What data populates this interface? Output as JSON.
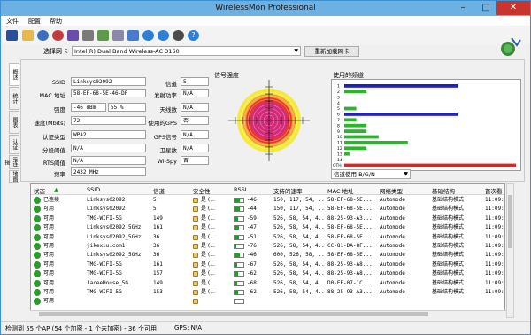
{
  "window": {
    "title": "WirelessMon Professional"
  },
  "menu": {
    "file": "文件",
    "config": "配置",
    "help": "帮助"
  },
  "toolbar": {
    "icons": [
      "save-icon",
      "open-icon",
      "globe-icon",
      "gps-icon",
      "monitor-icon",
      "print-icon",
      "bar-chart-icon",
      "settings-icon",
      "back-icon",
      "forward-icon",
      "network-icon",
      "help-icon"
    ]
  },
  "adapter": {
    "label": "选择网卡",
    "value": "Intel(R) Dual Band Wireless-AC 3160",
    "reload": "重新加载网卡"
  },
  "tabs": [
    "概述",
    "统计",
    "图表",
    "认证",
    "IP连接",
    "地图"
  ],
  "info": {
    "ssid_label": "SSID",
    "ssid": "Linksys02092",
    "mac_label": "MAC 地址",
    "mac": "58-EF-68-5E-46-DF",
    "strength_label": "强度",
    "strength_dbm": "-46 dBm",
    "strength_pct": "55 %",
    "speed_label": "速度(Mbits)",
    "speed": "72",
    "auth_label": "认证类型",
    "auth": "WPA2",
    "frag_label": "分段阈值",
    "frag": "N/A",
    "rts_label": "RTS阈值",
    "rts": "N/A",
    "freq_label": "频率",
    "freq": "2432 MHz",
    "channel_label": "信道",
    "channel": "5",
    "txpower_label": "发射功率",
    "txpower": "N/A",
    "antenna_label": "天线数",
    "antenna": "N/A",
    "gps_label": "使用的GPS",
    "gps": "否",
    "gpssignal_label": "GPS信号",
    "gpssignal": "N/A",
    "sats_label": "卫星数",
    "sats": "N/A",
    "wispy_label": "Wi-Spy",
    "wispy": "否"
  },
  "signal": {
    "title": "信号强度",
    "level_pct": 55
  },
  "channels": {
    "title": "使用的频道",
    "select": "信道使用 B/G/N",
    "labels": [
      "1",
      "2",
      "3",
      "4",
      "5",
      "6",
      "7",
      "8",
      "9",
      "10",
      "11",
      "12",
      "13",
      "14",
      "OTH"
    ],
    "bars": [
      {
        "ch": "1",
        "value": 0.66,
        "color": "#1f1fc8"
      },
      {
        "ch": "2",
        "value": 0.13,
        "color": "#2bb52b"
      },
      {
        "ch": "3",
        "value": 0.0,
        "color": "#2bb52b"
      },
      {
        "ch": "4",
        "value": 0.0,
        "color": "#2bb52b"
      },
      {
        "ch": "5",
        "value": 0.07,
        "color": "#2bb52b"
      },
      {
        "ch": "6",
        "value": 0.66,
        "color": "#1f1fc8"
      },
      {
        "ch": "7",
        "value": 0.07,
        "color": "#2bb52b"
      },
      {
        "ch": "8",
        "value": 0.13,
        "color": "#2bb52b"
      },
      {
        "ch": "9",
        "value": 0.13,
        "color": "#2bb52b"
      },
      {
        "ch": "10",
        "value": 0.2,
        "color": "#2bb52b"
      },
      {
        "ch": "11",
        "value": 0.37,
        "color": "#2bb52b"
      },
      {
        "ch": "12",
        "value": 0.13,
        "color": "#2bb52b"
      },
      {
        "ch": "13",
        "value": 0.03,
        "color": "#2bb52b"
      },
      {
        "ch": "14",
        "value": 0.0,
        "color": "#2bb52b"
      },
      {
        "ch": "OTH",
        "value": 1.0,
        "color": "#e02424"
      }
    ]
  },
  "table": {
    "headers": [
      "状态",
      "SSID",
      "信道",
      "安全性",
      "RSSI",
      "支持的速率",
      "MAC 地址",
      "网络类型",
      "基础结构",
      "首次看"
    ],
    "rows": [
      {
        "status": "已连接",
        "color": "#2d9a2d",
        "ssid": "Linksys02092",
        "ch": "5",
        "sec": "是 (...",
        "rssi": "-46",
        "lvl": 0.55,
        "rates": "150, 117, 54, ...",
        "mac": "58-EF-68-5E...",
        "type": "Automode",
        "infra": "基础结构模式",
        "first": "11:09:"
      },
      {
        "status": "可用",
        "color": "#2d9a2d",
        "ssid": "Linksys02092",
        "ch": "5",
        "sec": "是 (...",
        "rssi": "-44",
        "lvl": 0.57,
        "rates": "150, 117, 54, ...",
        "mac": "58-EF-68-5E...",
        "type": "Automode",
        "infra": "基础结构模式",
        "first": "11:09:"
      },
      {
        "status": "可用",
        "color": "#2d9a2d",
        "ssid": "TMG-WIFI-5G",
        "ch": "149",
        "sec": "是 (...",
        "rssi": "-59",
        "lvl": 0.4,
        "rates": "526, 58, 54, 4...",
        "mac": "88-25-93-A3...",
        "type": "Automode",
        "infra": "基础结构模式",
        "first": "11:09:"
      },
      {
        "status": "可用",
        "color": "#2d9a2d",
        "ssid": "Linksys02092_5GHz",
        "ch": "161",
        "sec": "是 (...",
        "rssi": "-47",
        "lvl": 0.52,
        "rates": "526, 58, 54, 4...",
        "mac": "58-EF-68-5E...",
        "type": "Automode",
        "infra": "基础结构模式",
        "first": "11:09:"
      },
      {
        "status": "可用",
        "color": "#2d9a2d",
        "ssid": "Linksys02092_5GHz",
        "ch": "36",
        "sec": "是 (...",
        "rssi": "-51",
        "lvl": 0.48,
        "rates": "526, 58, 54, 4...",
        "mac": "58-EF-68-5E...",
        "type": "Automode",
        "infra": "基础结构模式",
        "first": "11:09:"
      },
      {
        "status": "可用",
        "color": "#2d9a2d",
        "ssid": "jikexiu.com1",
        "ch": "36",
        "sec": "是 (...",
        "rssi": "-76",
        "lvl": 0.2,
        "rates": "526, 58, 54, 4...",
        "mac": "CC-81-DA-8F...",
        "type": "Automode",
        "infra": "基础结构模式",
        "first": "11:09:"
      },
      {
        "status": "可用",
        "color": "#2d9a2d",
        "ssid": "Linksys02092_5GHz",
        "ch": "36",
        "sec": "是 (...",
        "rssi": "-46",
        "lvl": 0.55,
        "rates": "600, 526, 58, ...",
        "mac": "58-EF-68-5E...",
        "type": "Automode",
        "infra": "基础结构模式",
        "first": "11:09:"
      },
      {
        "status": "可用",
        "color": "#2d9a2d",
        "ssid": "TMG-WIFI-5G",
        "ch": "161",
        "sec": "是 (...",
        "rssi": "-67",
        "lvl": 0.3,
        "rates": "526, 58, 54, 4...",
        "mac": "88-25-93-A8...",
        "type": "Automode",
        "infra": "基础结构模式",
        "first": "11:09:"
      },
      {
        "status": "可用",
        "color": "#2d9a2d",
        "ssid": "TMG-WIFI-5G",
        "ch": "157",
        "sec": "是 (...",
        "rssi": "-62",
        "lvl": 0.35,
        "rates": "526, 58, 54, 4...",
        "mac": "88-25-93-A8...",
        "type": "Automode",
        "infra": "基础结构模式",
        "first": "11:09:"
      },
      {
        "status": "可用",
        "color": "#2d9a2d",
        "ssid": "JaceeHouse_5G",
        "ch": "149",
        "sec": "是 (...",
        "rssi": "-68",
        "lvl": 0.28,
        "rates": "526, 58, 54, 4...",
        "mac": "D0-EE-07-1C...",
        "type": "Automode",
        "infra": "基础结构模式",
        "first": "11:09:"
      },
      {
        "status": "可用",
        "color": "#2d9a2d",
        "ssid": "TMG-WIFI-5G",
        "ch": "153",
        "sec": "是 (...",
        "rssi": "-62",
        "lvl": 0.35,
        "rates": "526, 58, 54, 4...",
        "mac": "88-25-93-A3...",
        "type": "Automode",
        "infra": "基础结构模式",
        "first": "11:09:"
      },
      {
        "status": "可用",
        "color": "#2d9a2d",
        "ssid": "",
        "ch": "",
        "sec": "",
        "rssi": "",
        "lvl": 0,
        "rates": "",
        "mac": "",
        "type": "",
        "infra": "",
        "first": ""
      }
    ]
  },
  "status": {
    "text": "检测到 55 个AP (54 个加密 - 1 个未加密) - 36 个可用",
    "gps": "GPS: N/A"
  }
}
